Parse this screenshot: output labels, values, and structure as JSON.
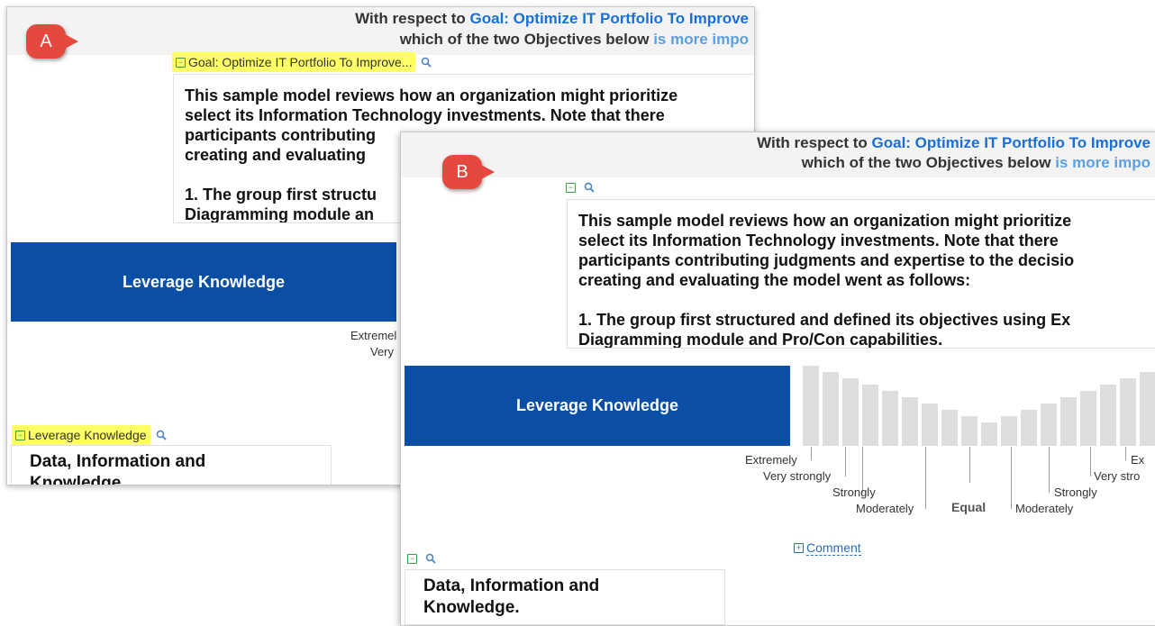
{
  "panel_a": {
    "badge": "A",
    "header": {
      "line1_prefix": "With respect to ",
      "line1_goal": "Goal: Optimize IT Portfolio To Improve",
      "line2_prefix": "which of the two Objectives below ",
      "line2_emph": "is more impo"
    },
    "goal_node_label": "Goal: Optimize IT Portfolio To Improve...",
    "description_lines": [
      "This sample model reviews how an organization might prioritize",
      "select its Information Technology investments.  Note that there",
      "participants contributing",
      "creating and evaluating",
      "",
      "1. The group first structu",
      "Diagramming module an"
    ],
    "objective_block": "Leverage Knowledge",
    "scale_partial": [
      "Extremel",
      "Very"
    ],
    "objective_node_label": "Leverage Knowledge",
    "objective_desc_lines": [
      "Data, Information and",
      "Knowledge."
    ]
  },
  "panel_b": {
    "badge": "B",
    "header": {
      "line1_prefix": "With respect to ",
      "line1_goal": "Goal: Optimize IT Portfolio To Improve",
      "line2_prefix": "which of the two Objectives below ",
      "line2_emph": "is more impo"
    },
    "description_lines": [
      "This sample model reviews how an organization might prioritize",
      "select its Information Technology investments.  Note that there",
      "participants contributing judgments and expertise to the decisio",
      "creating and evaluating the model went as follows:",
      "",
      "1. The group first structured and defined its objectives using Ex",
      "Diagramming module and Pro/Con capabilities."
    ],
    "objective_block": "Leverage Knowledge",
    "scale_labels": {
      "left_extremely": "Extremely",
      "left_very_strongly": "Very strongly",
      "left_strongly": "Strongly",
      "left_moderately": "Moderately",
      "equal": "Equal",
      "right_moderately": "Moderately",
      "right_strongly": "Strongly",
      "right_very_strongly": "Very stro",
      "right_extremely": "Ex"
    },
    "comment_link": "Comment",
    "objective_desc_lines": [
      "Data, Information and",
      "Knowledge."
    ]
  },
  "colors": {
    "badge": "#e5483f",
    "objective_block": "#0b4ea6",
    "link_blue": "#1a6fd6",
    "highlight": "#ffff66",
    "bar_gray": "#dedede"
  }
}
